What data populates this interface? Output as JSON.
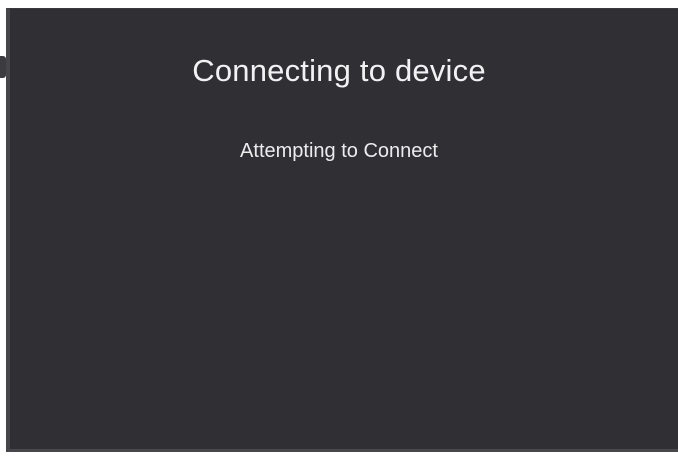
{
  "dialog": {
    "title": "Connecting to device",
    "status": "Attempting to Connect"
  },
  "colors": {
    "dialog_background": "#303034",
    "text": "#f2f2f2"
  }
}
